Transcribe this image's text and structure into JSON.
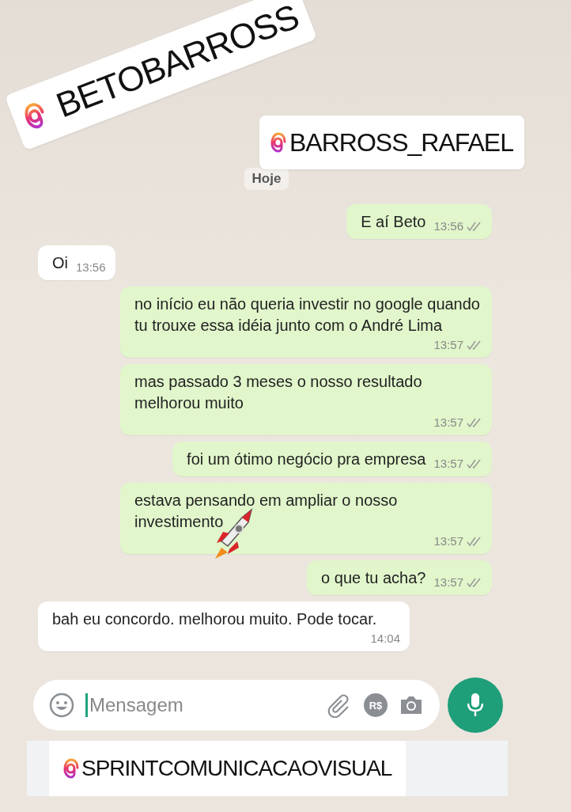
{
  "stickers": [
    {
      "handle": "BETOBARROSS",
      "tilted": true
    },
    {
      "handle": "BARROSS_RAFAEL",
      "tilted": false
    }
  ],
  "date_chip": "Hoje",
  "messages": [
    {
      "kind": "outgoing",
      "text": "E aí Beto",
      "time": "13:56"
    },
    {
      "kind": "incoming",
      "text": "Oi",
      "time": "13:56"
    },
    {
      "kind": "outgoing",
      "text": "no início eu não queria investir no google quando tu trouxe essa idéia junto com o André Lima",
      "time": "13:57"
    },
    {
      "kind": "outgoing",
      "text": "mas passado 3 meses o nosso resultado melhorou muito",
      "time": "13:57"
    },
    {
      "kind": "outgoing",
      "text": "foi um ótimo negócio pra empresa",
      "time": "13:57"
    },
    {
      "kind": "outgoing",
      "text": "estava pensando em ampliar o nosso investimento",
      "time": "13:57",
      "rocket": true
    },
    {
      "kind": "outgoing",
      "text": "o que tu acha?",
      "time": "13:57"
    },
    {
      "kind": "incoming",
      "text": "bah eu concordo. melhorou muito. Pode tocar.",
      "time": "14:04"
    }
  ],
  "composer": {
    "placeholder": "Mensagem",
    "currency": "R$"
  },
  "bottom_sticker": {
    "handle": "SPRINTCOMUNICACAOVISUAL"
  }
}
